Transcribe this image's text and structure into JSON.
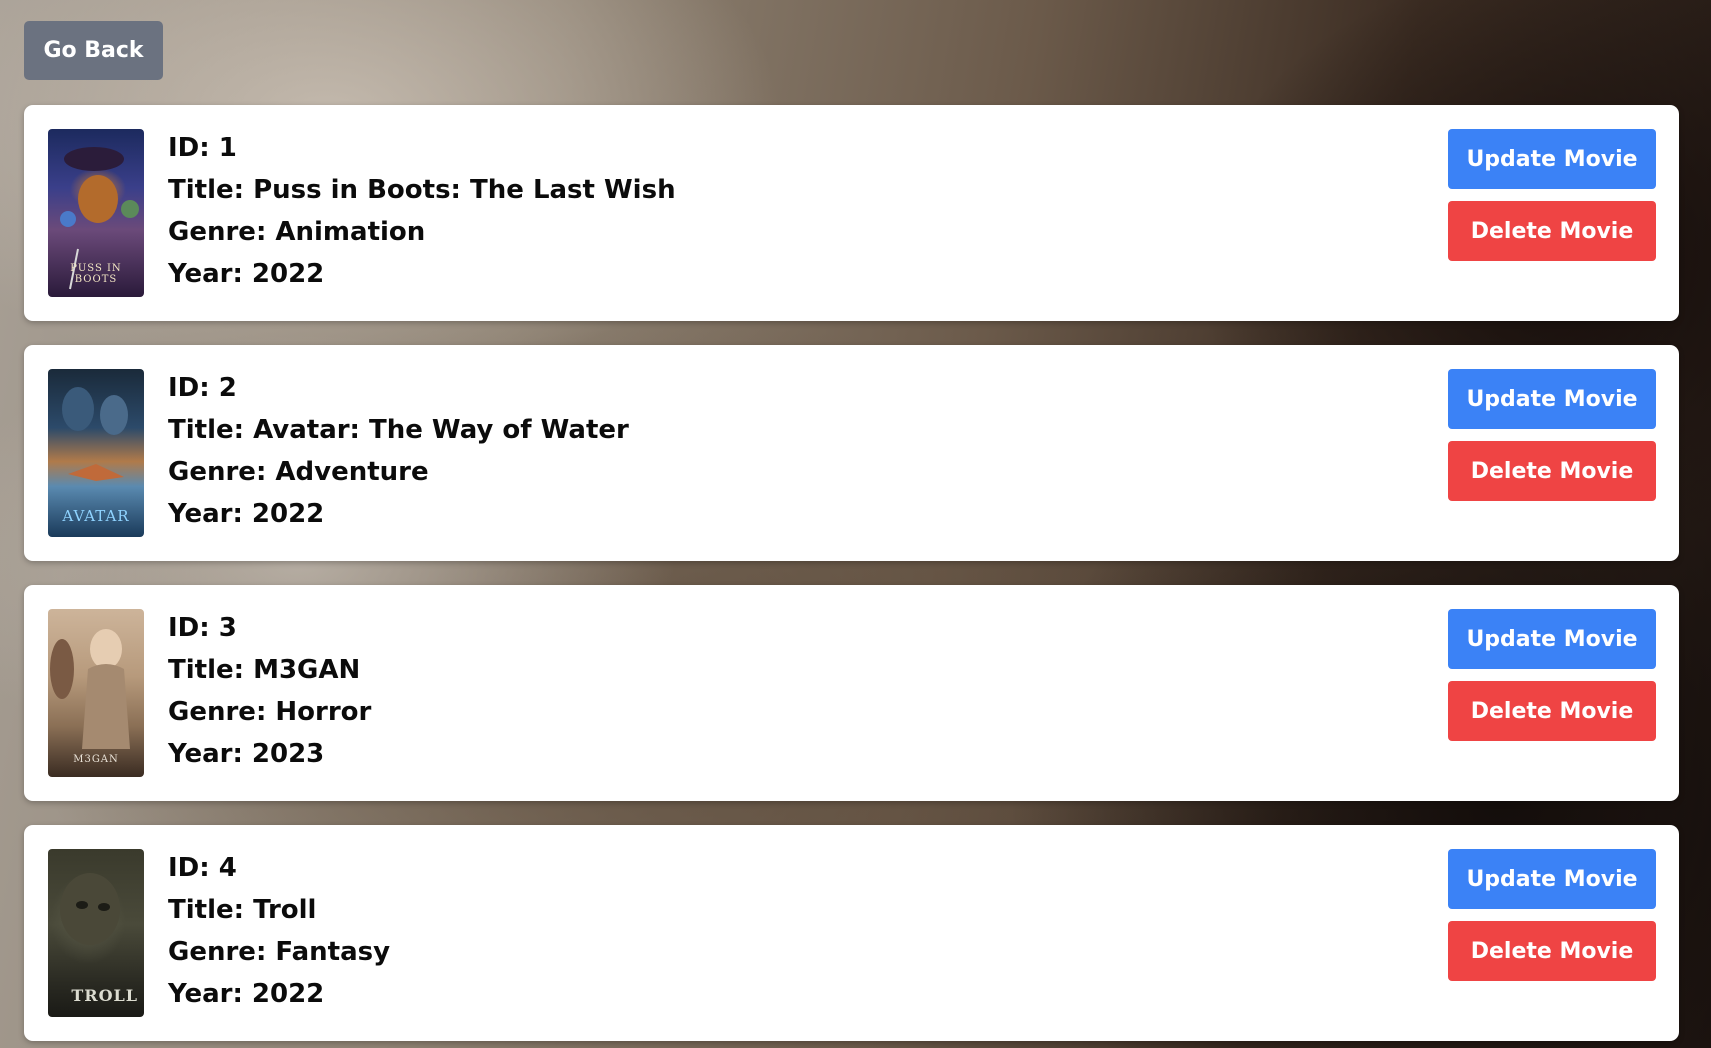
{
  "nav": {
    "go_back_label": "Go Back"
  },
  "actions": {
    "update_label": "Update Movie",
    "delete_label": "Delete Movie"
  },
  "movies": [
    {
      "id_text": "ID: 1",
      "title_text": "Title: Puss in Boots: The Last Wish",
      "genre_text": "Genre: Animation",
      "year_text": "Year: 2022",
      "poster_caption": "PUSS IN BOOTS"
    },
    {
      "id_text": "ID: 2",
      "title_text": "Title: Avatar: The Way of Water",
      "genre_text": "Genre: Adventure",
      "year_text": "Year: 2022",
      "poster_caption": "AVATAR"
    },
    {
      "id_text": "ID: 3",
      "title_text": "Title: M3GAN",
      "genre_text": "Genre: Horror",
      "year_text": "Year: 2023",
      "poster_caption": "M3GAN"
    },
    {
      "id_text": "ID: 4",
      "title_text": "Title: Troll",
      "genre_text": "Genre: Fantasy",
      "year_text": "Year: 2022",
      "poster_caption": "TROLL"
    }
  ]
}
